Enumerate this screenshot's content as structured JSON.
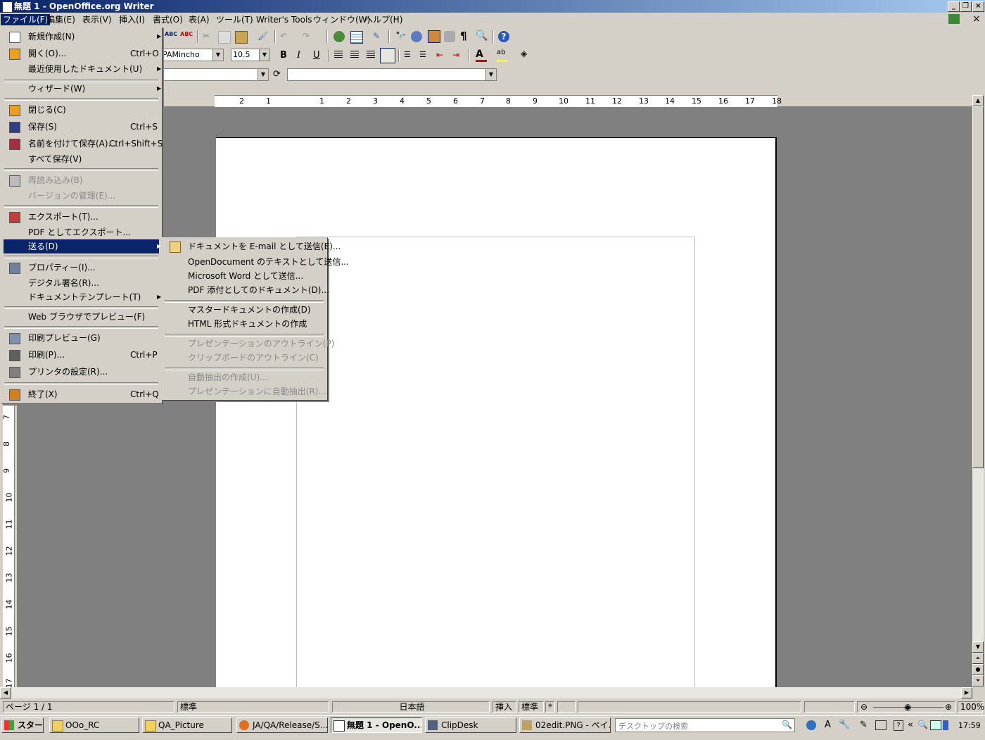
{
  "window": {
    "title": "無題 1 - OpenOffice.org Writer"
  },
  "menubar": [
    "ファイル(F)",
    "編集(E)",
    "表示(V)",
    "挿入(I)",
    "書式(O)",
    "表(A)",
    "ツール(T)",
    "Writer's Tools",
    "ウィンドウ(W)",
    "ヘルプ(H)"
  ],
  "formatting": {
    "font": "PAMincho",
    "size": "10.5"
  },
  "file_menu": [
    {
      "label": "新規作成(N)",
      "arrow": true
    },
    {
      "label": "開く(O)...",
      "shortcut": "Ctrl+O"
    },
    {
      "label": "最近使用したドキュメント(U)",
      "arrow": true
    },
    {
      "label": "ウィザード(W)",
      "arrow": true
    },
    {
      "label": "閉じる(C)"
    },
    {
      "label": "保存(S)",
      "shortcut": "Ctrl+S"
    },
    {
      "label": "名前を付けて保存(A)...",
      "shortcut": "Ctrl+Shift+S"
    },
    {
      "label": "すべて保存(V)"
    },
    {
      "label": "再読み込み(B)"
    },
    {
      "label": "バージョンの管理(E)..."
    },
    {
      "label": "エクスポート(T)..."
    },
    {
      "label": "PDF としてエクスポート..."
    },
    {
      "label": "送る(D)",
      "arrow": true
    },
    {
      "label": "プロパティー(I)..."
    },
    {
      "label": "デジタル署名(R)..."
    },
    {
      "label": "ドキュメントテンプレート(T)",
      "arrow": true
    },
    {
      "label": "Web ブラウザでプレビュー(F)"
    },
    {
      "label": "印刷プレビュー(G)"
    },
    {
      "label": "印刷(P)...",
      "shortcut": "Ctrl+P"
    },
    {
      "label": "プリンタの設定(R)..."
    },
    {
      "label": "終了(X)",
      "shortcut": "Ctrl+Q"
    }
  ],
  "send_menu": [
    {
      "label": "ドキュメントを E-mail として送信(E)..."
    },
    {
      "label": "OpenDocument のテキストとして送信..."
    },
    {
      "label": "Microsoft Word として送信..."
    },
    {
      "label": "PDF 添付としてのドキュメント(D)..."
    },
    {
      "label": "マスタードキュメントの作成(D)"
    },
    {
      "label": "HTML 形式ドキュメントの作成"
    },
    {
      "label": "プレゼンテーションのアウトライン(P)"
    },
    {
      "label": "クリップボードのアウトライン(C)"
    },
    {
      "label": "自動抽出の作成(U)..."
    },
    {
      "label": "プレゼンテーションに自動抽出(R)..."
    }
  ],
  "hruler_labels": [
    "2",
    "1",
    "1",
    "2",
    "3",
    "4",
    "5",
    "6",
    "7",
    "8",
    "9",
    "10",
    "11",
    "12",
    "13",
    "14",
    "15",
    "16",
    "17",
    "18"
  ],
  "vruler_labels": [
    "7",
    "8",
    "9",
    "10",
    "11",
    "12",
    "13",
    "14",
    "15",
    "16",
    "17"
  ],
  "status": {
    "page": "ページ 1 / 1",
    "style": "標準",
    "language": "日本語",
    "insert": "挿入",
    "selection": "標準",
    "modified": "*",
    "zoom": "100%"
  },
  "taskbar": {
    "start": "スタート",
    "tasks": [
      "OOo_RC",
      "QA_Picture",
      "JA/QA/Release/S...",
      "無題 1 - OpenO...",
      "ClipDesk",
      "02edit.PNG - ペイ..."
    ],
    "search_placeholder": "デスクトップの検索",
    "clock": "17:59"
  }
}
